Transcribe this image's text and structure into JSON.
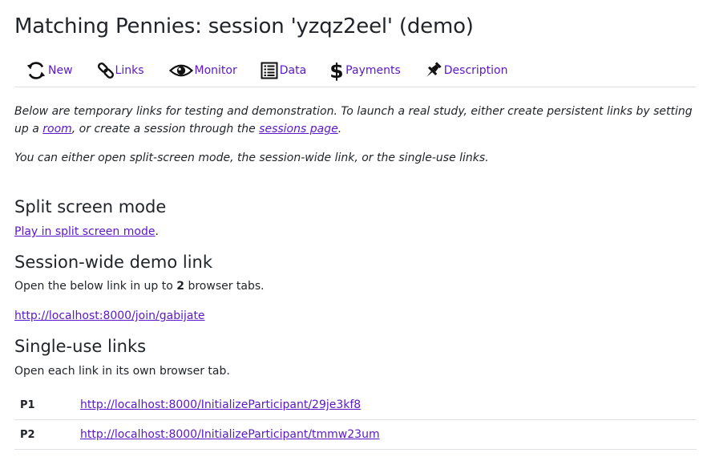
{
  "header": {
    "title": "Matching Pennies: session 'yzqz2eel' (demo)"
  },
  "nav": {
    "items": [
      {
        "label": "New",
        "icon": "refresh-icon"
      },
      {
        "label": "Links",
        "icon": "link-icon"
      },
      {
        "label": "Monitor",
        "icon": "eye-icon"
      },
      {
        "label": "Data",
        "icon": "spreadsheet-icon"
      },
      {
        "label": "Payments",
        "icon": "dollar-icon"
      },
      {
        "label": "Description",
        "icon": "pushpin-icon"
      }
    ]
  },
  "intro": {
    "p1_before": "Below are temporary links for testing and demonstration. To launch a real study, either create persistent links by setting up a ",
    "p1_room": "room",
    "p1_middle": ", or create a session through the ",
    "p1_sessions": "sessions page",
    "p1_after": ".",
    "p2": "You can either open split-screen mode, the session-wide link, or the single-use links."
  },
  "split": {
    "heading": "Split screen mode",
    "link": "Play in split screen mode",
    "after": "."
  },
  "session_wide": {
    "heading": "Session-wide demo link",
    "text_before": "Open the below link in up to ",
    "count": "2",
    "text_after": " browser tabs.",
    "url": "http://localhost:8000/join/gabijate"
  },
  "single_use": {
    "heading": "Single-use links",
    "text": "Open each link in its own browser tab.",
    "rows": [
      {
        "code": "P1",
        "url": "http://localhost:8000/InitializeParticipant/29je3kf8"
      },
      {
        "code": "P2",
        "url": "http://localhost:8000/InitializeParticipant/tmmw23um"
      }
    ]
  },
  "colors": {
    "link": "#5a17c9",
    "text": "#212529",
    "border": "#dee2e6"
  }
}
